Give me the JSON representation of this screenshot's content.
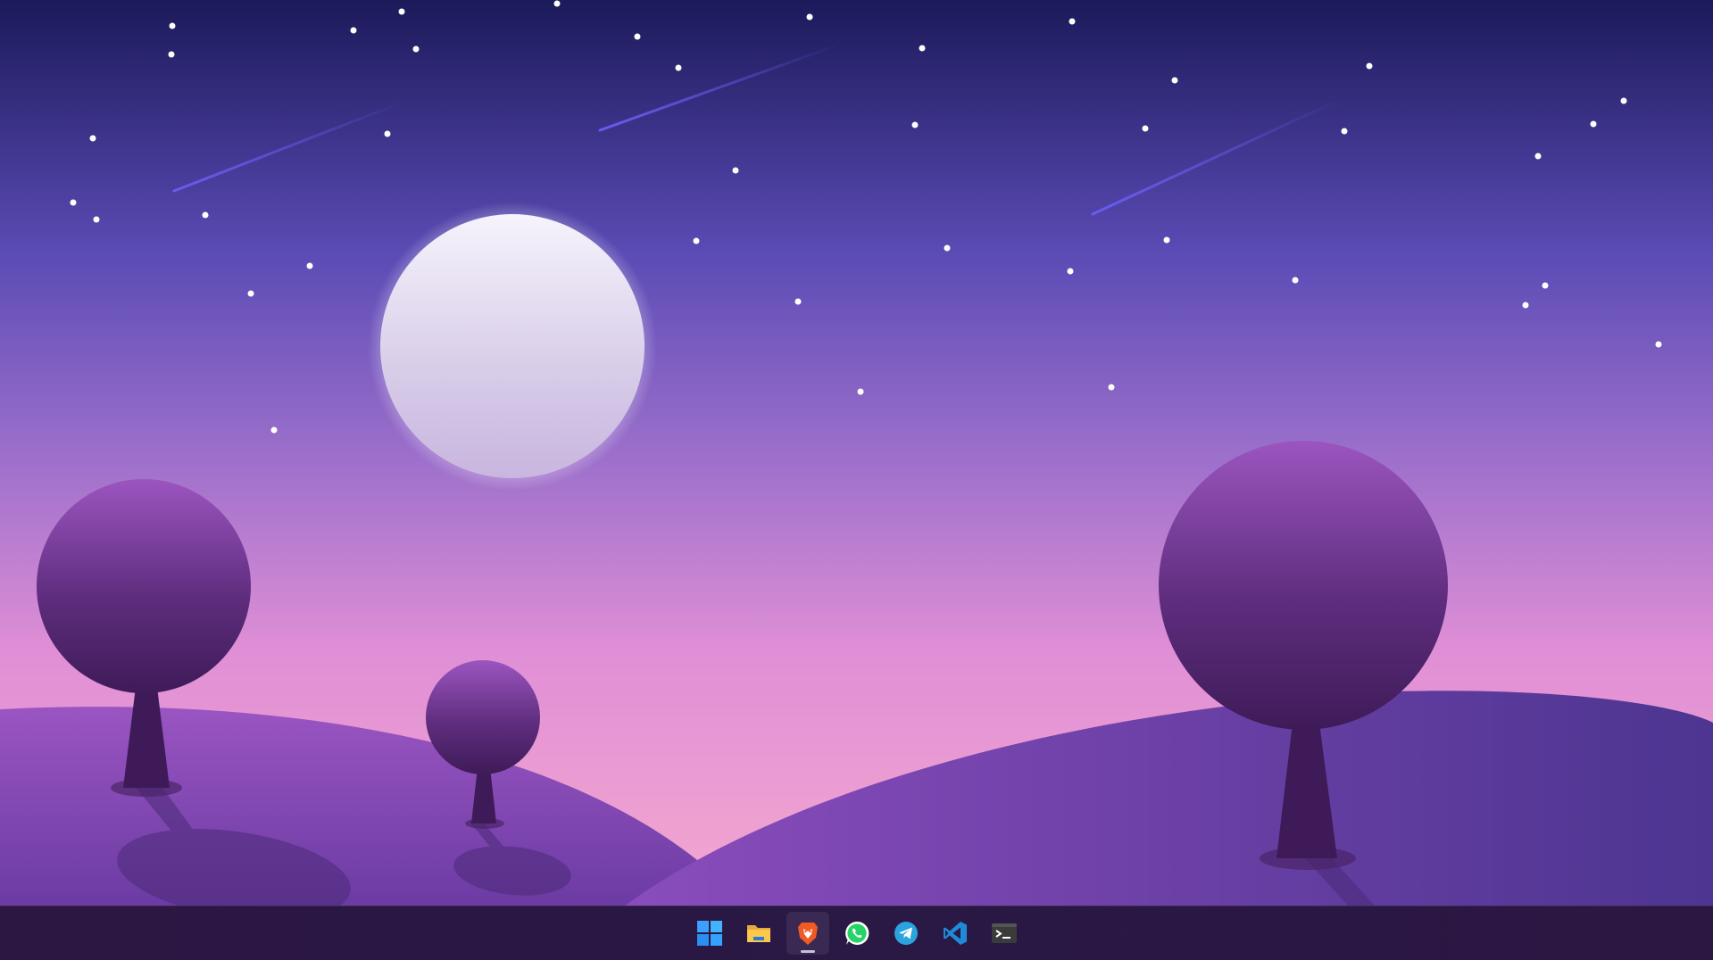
{
  "desktop": {
    "wallpaper": {
      "theme": "night-hills-moon",
      "colors": {
        "sky_top": "#1b1a5a",
        "sky_mid": "#5b4bb5",
        "horizon": "#e08fd6",
        "moon": "#f3f0fb",
        "hills": "#6f3fa5",
        "tree": "#4a2368"
      }
    }
  },
  "taskbar": {
    "background": "#2a1845",
    "items": [
      {
        "id": "start",
        "icon": "windows-start-icon",
        "active": false
      },
      {
        "id": "file-explorer",
        "icon": "folder-icon",
        "active": false
      },
      {
        "id": "brave",
        "icon": "brave-browser-icon",
        "active": true
      },
      {
        "id": "whatsapp",
        "icon": "whatsapp-icon",
        "active": false
      },
      {
        "id": "telegram",
        "icon": "telegram-icon",
        "active": false
      },
      {
        "id": "vscode",
        "icon": "vscode-icon",
        "active": false
      },
      {
        "id": "terminal",
        "icon": "terminal-icon",
        "active": false
      }
    ]
  }
}
